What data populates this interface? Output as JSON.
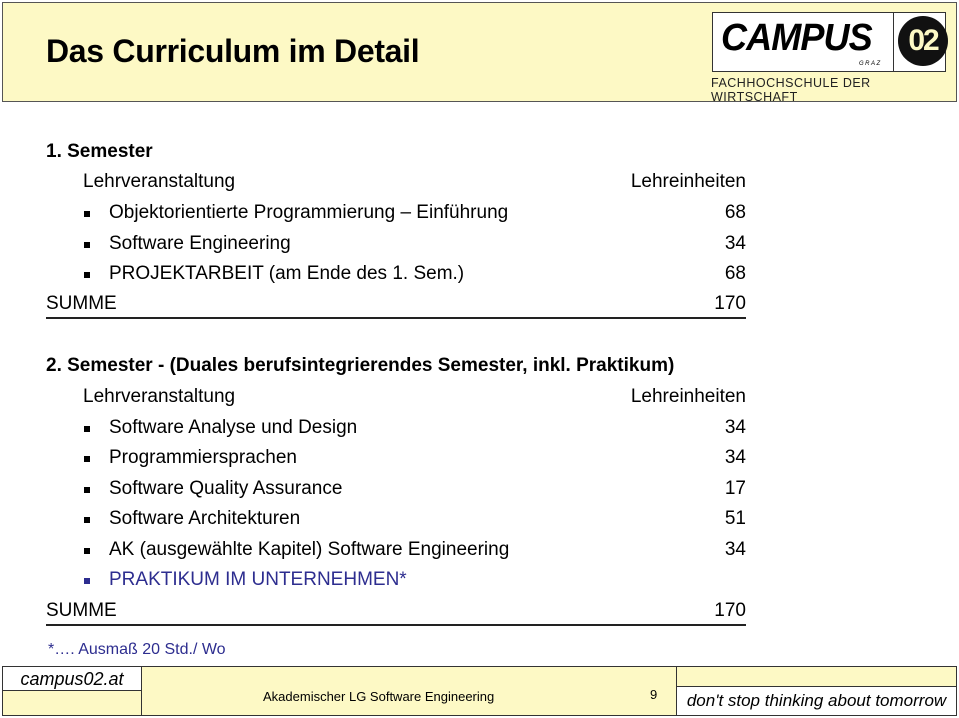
{
  "header": {
    "title": "Das Curriculum im Detail",
    "logo": {
      "name": "CAMPUS",
      "sub": "GRAZ",
      "badge": "02",
      "tagline": "FACHHOCHSCHULE DER WIRTSCHAFT"
    },
    "colors": {
      "background": "#fdf9c5"
    }
  },
  "semester1": {
    "title": "1. Semester",
    "col_course": "Lehrveranstaltung",
    "col_units": "Lehreinheiten",
    "courses": [
      {
        "name": "Objektorientierte Programmierung – Einführung",
        "units": "68"
      },
      {
        "name": "Software Engineering",
        "units": "34"
      },
      {
        "name": "PROJEKTARBEIT (am Ende des 1. Sem.)",
        "units": "68"
      }
    ],
    "sum_label": "SUMME",
    "sum_value": "170"
  },
  "semester2": {
    "title": "2. Semester - (Duales berufsintegrierendes Semester, inkl. Praktikum)",
    "col_course": "Lehrveranstaltung",
    "col_units": "Lehreinheiten",
    "courses": [
      {
        "name": "Software Analyse und Design",
        "units": "34"
      },
      {
        "name": "Programmiersprachen",
        "units": "34"
      },
      {
        "name": "Software Quality Assurance",
        "units": "17"
      },
      {
        "name": "Software Architekturen",
        "units": "51"
      },
      {
        "name": "AK (ausgewählte Kapitel) Software Engineering",
        "units": "34"
      },
      {
        "name": "PRAKTIKUM IM UNTERNEHMEN*",
        "units": "",
        "highlight_color": "#2d2d8f"
      }
    ],
    "sum_label": "SUMME",
    "sum_value": "170"
  },
  "footnote": "*…. Ausmaß 20 Std./ Wo",
  "footer": {
    "site": "campus02.at",
    "course": "Akademischer LG Software Engineering",
    "page": "9",
    "slogan": "don't stop thinking about tomorrow"
  }
}
